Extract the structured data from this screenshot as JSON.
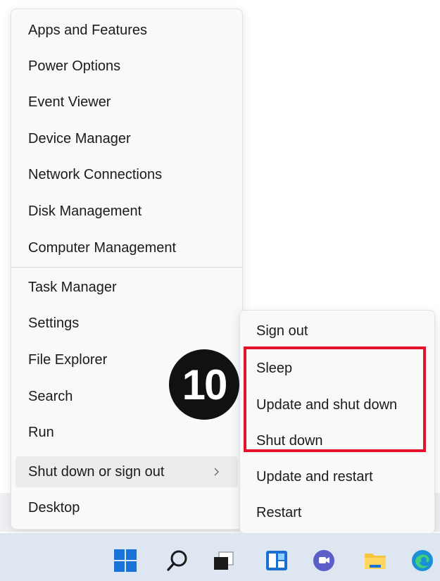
{
  "main_menu": {
    "items": [
      {
        "label": "Apps and Features"
      },
      {
        "label": "Power Options"
      },
      {
        "label": "Event Viewer"
      },
      {
        "label": "Device Manager"
      },
      {
        "label": "Network Connections"
      },
      {
        "label": "Disk Management"
      },
      {
        "label": "Computer Management"
      },
      {
        "label": "Task Manager"
      },
      {
        "label": "Settings"
      },
      {
        "label": "File Explorer"
      },
      {
        "label": "Search"
      },
      {
        "label": "Run"
      },
      {
        "label": "Shut down or sign out",
        "has_submenu": true,
        "highlighted": true
      },
      {
        "label": "Desktop"
      }
    ]
  },
  "submenu": {
    "items": [
      {
        "label": "Sign out"
      },
      {
        "label": "Sleep"
      },
      {
        "label": "Update and shut down"
      },
      {
        "label": "Shut down"
      },
      {
        "label": "Update and restart"
      },
      {
        "label": "Restart"
      }
    ]
  },
  "annotation": {
    "step_number": "10",
    "highlight_color": "#e3132c"
  },
  "taskbar": {
    "icons": [
      "start-windows-icon",
      "search-icon",
      "task-view-icon",
      "widgets-icon",
      "chat-icon",
      "file-explorer-icon",
      "edge-browser-icon"
    ]
  }
}
